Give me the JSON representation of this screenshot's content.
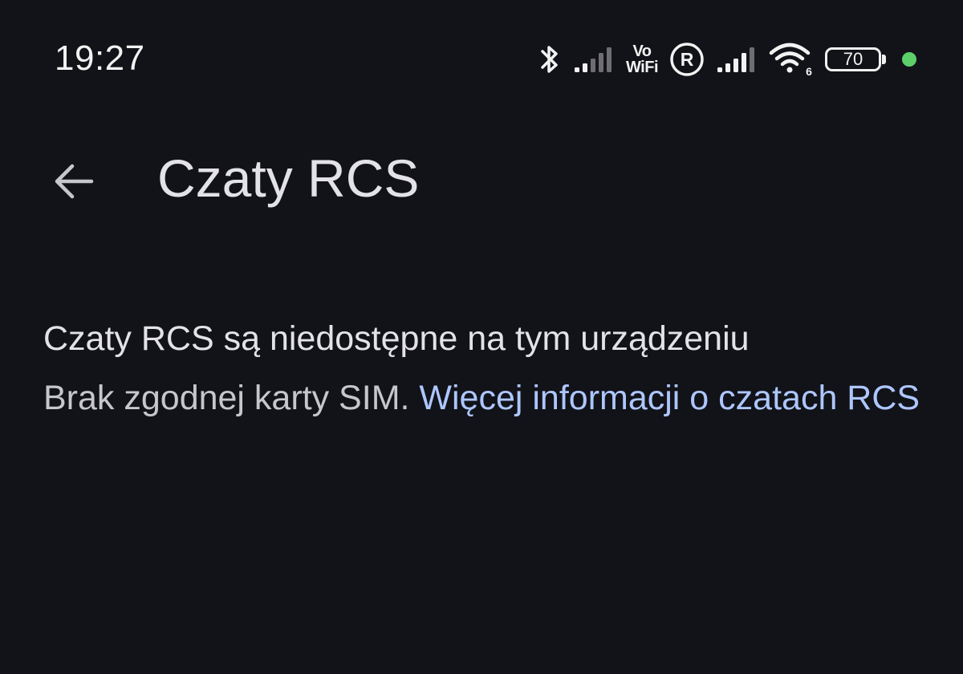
{
  "status_bar": {
    "time": "19:27",
    "icons": [
      "bluetooth-icon",
      "signal-icon",
      "vowifi-icon",
      "roaming-icon",
      "signal-icon",
      "wifi-icon",
      "battery-icon",
      "privacy-dot"
    ],
    "vowifi_top": "Vo",
    "vowifi_bottom": "WiFi",
    "roaming_letter": "R",
    "wifi_badge": "6",
    "battery_level": "70",
    "privacy_dot_color": "#5ccf6b"
  },
  "app_bar": {
    "back_icon": "arrow-back-icon",
    "title": "Czaty RCS"
  },
  "content": {
    "headline": "Czaty RCS są niedostępne na tym urządzeniu",
    "body": "Brak zgodnej karty SIM. ",
    "link": "Więcej informacji o czatach RCS"
  },
  "colors": {
    "background": "#121318",
    "text_primary": "#e3e2e6",
    "text_secondary": "#c6c6cc",
    "link": "#adc6ff"
  }
}
